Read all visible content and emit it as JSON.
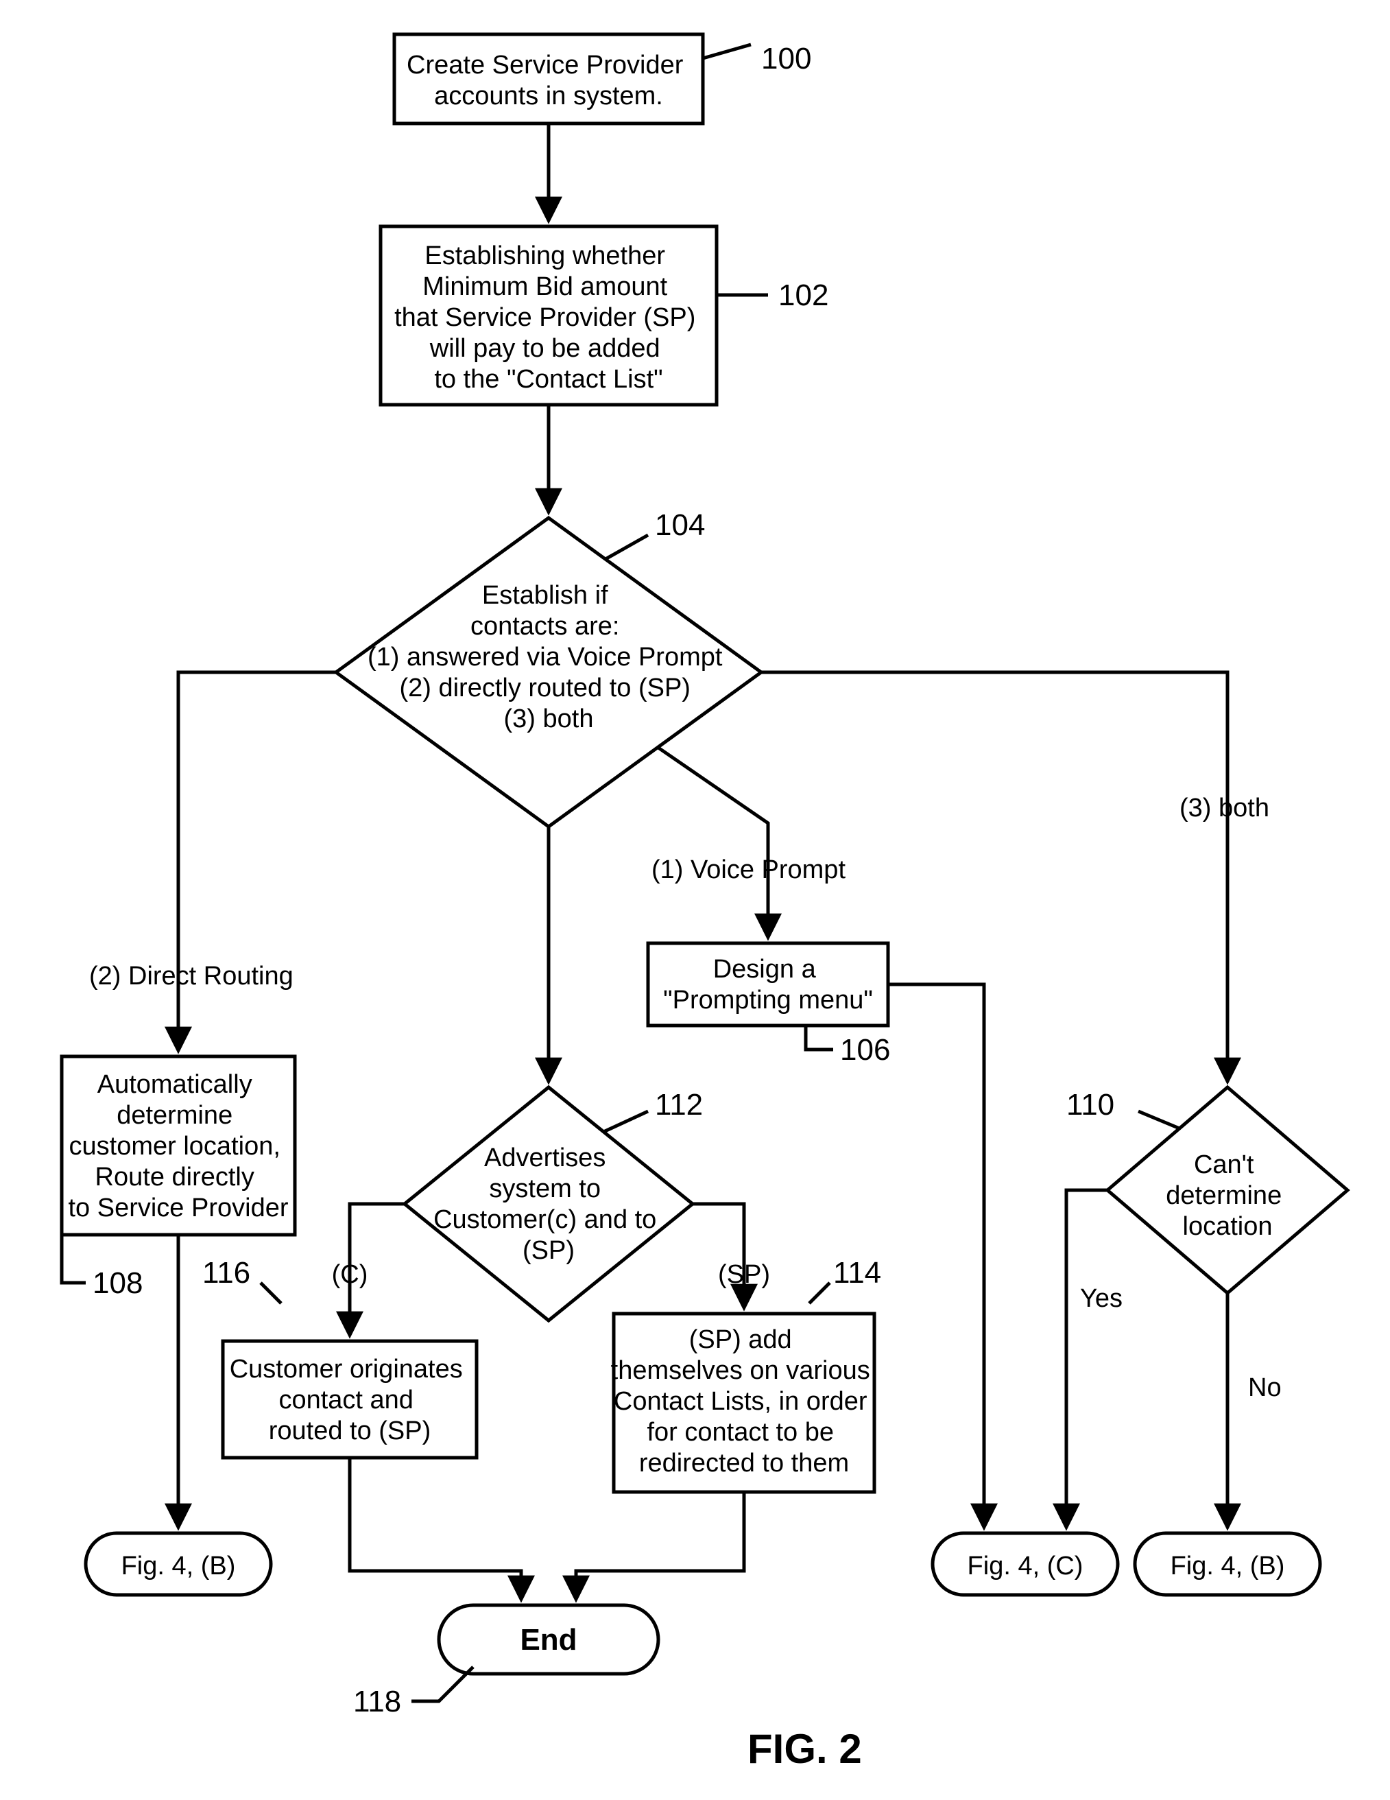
{
  "figure_label": "FIG. 2",
  "nodes": {
    "n100": {
      "ref": "100",
      "text": [
        "Create Service Provider",
        "accounts in system."
      ]
    },
    "n102": {
      "ref": "102",
      "text": [
        "Establishing whether",
        "Minimum Bid amount",
        "that Service Provider (SP)",
        "will pay to be added",
        "to the \"Contact List\""
      ]
    },
    "n104": {
      "ref": "104",
      "text": [
        "Establish if",
        "contacts are:",
        "(1) answered via Voice Prompt",
        "(2) directly routed to (SP)",
        "(3) both"
      ]
    },
    "n106": {
      "ref": "106",
      "text": [
        "Design a",
        "\"Prompting menu\""
      ]
    },
    "n108": {
      "ref": "108",
      "text": [
        "Automatically",
        "determine",
        "customer location,",
        "Route directly",
        "to Service Provider"
      ]
    },
    "n110": {
      "ref": "110",
      "text": [
        "Can't",
        "determine",
        "location"
      ]
    },
    "n112": {
      "ref": "112",
      "text": [
        "Advertises",
        "system to",
        "Customer(c) and to",
        "(SP)"
      ]
    },
    "n114": {
      "ref": "114",
      "text": [
        "(SP) add",
        "themselves on various",
        "Contact Lists, in order",
        "for contact to be",
        "redirected to them"
      ]
    },
    "n116": {
      "ref": "116",
      "text": [
        "Customer originates",
        "contact and",
        "routed to (SP)"
      ]
    },
    "n118": {
      "ref": "118",
      "text": [
        "End"
      ]
    }
  },
  "terminals": {
    "t_b_left": {
      "text": "Fig. 4, (B)"
    },
    "t_c": {
      "text": "Fig. 4, (C)"
    },
    "t_b_right": {
      "text": "Fig. 4, (B)"
    }
  },
  "edge_labels": {
    "direct_routing": "(2) Direct Routing",
    "voice_prompt": "(1) Voice Prompt",
    "both": "(3) both",
    "c": "(C)",
    "sp": "(SP)",
    "yes": "Yes",
    "no": "No"
  }
}
